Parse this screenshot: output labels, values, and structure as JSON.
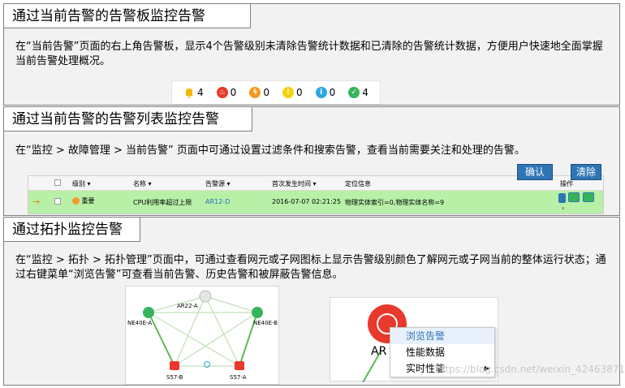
{
  "sections": [
    {
      "title": "通过当前告警的告警板监控告警",
      "text": "在“当前告警”页面的右上角告警板，显示4个告警级别未清除告警统计数据和已清除的告警统计数据，方便用户快速地全面掌握当前告警处理概况。"
    },
    {
      "title": "通过当前告警的告警列表监控告警",
      "text": "在“监控 > 故障管理 > 当前告警” 页面中可通过设置过滤条件和搜索告警，查看当前需要关注和处理的告警。"
    },
    {
      "title": "通过拓扑监控告警",
      "text": "在“监控 > 拓扑 > 拓扑管理”页面中，可通过查看网元或子网图标上显示告警级别颜色了解网元或子网当前的整体运行状态；通过右键菜单“浏览告警”可查看当前告警、历史告警和被屏蔽告警信息。"
    }
  ],
  "alarm_board": [
    {
      "icon": "bell-icon",
      "count": "4",
      "color": "#f5b400"
    },
    {
      "icon": "critical-icon",
      "count": "0",
      "color": "#e8392c"
    },
    {
      "icon": "major-icon",
      "count": "0",
      "color": "#f59a23"
    },
    {
      "icon": "minor-icon",
      "count": "0",
      "color": "#f7d10a"
    },
    {
      "icon": "warning-info-icon",
      "count": "0",
      "color": "#2ea7e0"
    },
    {
      "icon": "cleared-icon",
      "count": "4",
      "color": "#36b45a"
    }
  ],
  "alarm_grid": {
    "headers": [
      "级别",
      "名称",
      "告警源",
      "首次发生时间",
      "定位信息",
      "操作"
    ],
    "row": {
      "level": "重要",
      "name": "CPU利用率超过上限",
      "source": "AR12-D",
      "time": "2016-07-07 02:21:25",
      "location": "物理实体索引=0,物理实体名称=9"
    },
    "confirm_label": "确认",
    "clear_label": "清除"
  },
  "topology": {
    "nodes": [
      "AR22-A",
      "NE40E-A",
      "NE40E-B",
      "S57-B",
      "S57-A"
    ]
  },
  "context": {
    "node_label": "AR",
    "menu": [
      "浏览告警",
      "性能数据",
      "实时性能"
    ]
  },
  "watermark": "https://blog.csdn.net/weixin_42463871"
}
